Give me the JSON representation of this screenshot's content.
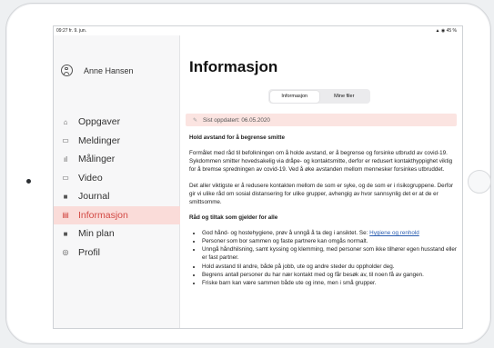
{
  "status_bar": {
    "time": "09:27  fr. 9. jun.",
    "indicators": "▲ ◉ 45 %"
  },
  "sidebar": {
    "user_name": "Anne Hansen",
    "items": [
      {
        "label": "Oppgaver",
        "icon": "home-icon",
        "glyph": "⌂"
      },
      {
        "label": "Meldinger",
        "icon": "chat-icon",
        "glyph": "▭"
      },
      {
        "label": "Målinger",
        "icon": "bar-chart-icon",
        "glyph": "ıl"
      },
      {
        "label": "Video",
        "icon": "video-icon",
        "glyph": "▭"
      },
      {
        "label": "Journal",
        "icon": "journal-icon",
        "glyph": "■"
      },
      {
        "label": "Informasjon",
        "icon": "document-icon",
        "glyph": "▤",
        "active": true
      },
      {
        "label": "Min plan",
        "icon": "plan-icon",
        "glyph": "■"
      },
      {
        "label": "Profil",
        "icon": "profile-icon",
        "glyph": "◎"
      }
    ]
  },
  "main": {
    "title": "Informasjon",
    "tabs": [
      {
        "label": "Informasjon",
        "active": true
      },
      {
        "label": "Mine filer",
        "active": false
      }
    ],
    "updated": "Sist oppdatert: 06.05.2020",
    "section1_heading": "Hold avstand for å begrense smitte",
    "paragraph1": "Formålet med råd til befolkningen om å holde avstand, er å begrense og forsinke utbrudd av covid-19. Sykdommen smitter hovedsakelig via dråpe- og kontaktsmitte, derfor er redusert kontakthyppighet viktig for å bremse spredningen av covid-19. Ved å øke avstanden mellom mennesker forsinkes utbruddet.",
    "paragraph2": "Det aller viktigste er å redusere kontakten mellom de som er syke, og de som er i risikogruppene. Derfor gir vi ulike råd om sosial distansering for ulike grupper, avhengig av hvor sannsynlig det er at de er smittsomme.",
    "section2_heading": "Råd og tiltak som gjelder for alle",
    "bullet1_text": "God hånd- og hostehygiene, prøv å unngå å ta deg i ansiktet. Se: ",
    "bullet1_link": "Hygiene og renhold",
    "bullets": [
      "Personer som bor sammen og faste partnere kan omgås normalt.",
      "Unngå håndhilsning, samt kyssing og klemming, med personer som ikke tilhører egen husstand eller er fast partner.",
      "Hold avstand til andre, både på jobb, ute og andre steder du oppholder deg.",
      "Begrens antall personer du har nær kontakt med og får besøk av, til noen få av gangen.",
      "Friske barn kan være sammen både ute og inne, men i små grupper."
    ]
  },
  "colors": {
    "accent": "#d24a45",
    "active_bg": "#fadcd9",
    "updated_bg": "#fbe4e1",
    "link": "#2a5db0"
  }
}
